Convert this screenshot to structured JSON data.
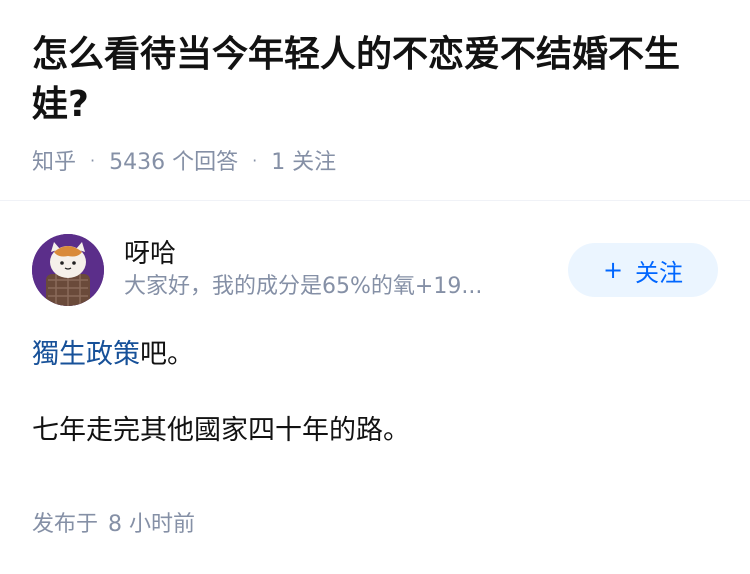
{
  "question": {
    "title": "怎么看待当今年轻人的不恋爱不结婚不生娃?",
    "source": "知乎",
    "answer_count": "5436 个回答",
    "follow_count": "1 关注"
  },
  "answer": {
    "author": {
      "name": "呀哈",
      "bio": "大家好，我的成分是65%的氧+19..."
    },
    "follow_button": {
      "icon": "+",
      "label": "关注"
    },
    "content": {
      "paragraph1_link": "獨生政策",
      "paragraph1_rest": "吧。",
      "paragraph2": "七年走完其他國家四十年的路。"
    },
    "publish": {
      "label": "发布于",
      "time": "8 小时前"
    }
  },
  "colors": {
    "accent": "#0066ff",
    "accent_bg": "#ebf5ff",
    "link": "#175199",
    "muted": "#8590a6",
    "avatar_bg": "#5b2e8a"
  }
}
